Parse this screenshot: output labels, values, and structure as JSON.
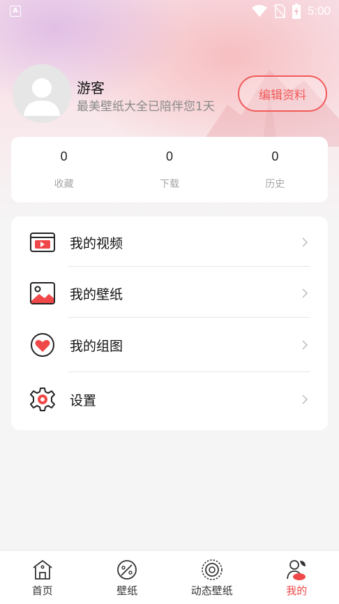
{
  "status_bar": {
    "time": "5:00",
    "icons": [
      "app-notification-icon",
      "wifi-icon",
      "no-sim-icon",
      "battery-icon"
    ]
  },
  "profile": {
    "username": "游客",
    "subtitle": "最美壁纸大全已陪伴您1天",
    "edit_button": "编辑资料"
  },
  "stats": [
    {
      "value": "0",
      "label": "收藏"
    },
    {
      "value": "0",
      "label": "下载"
    },
    {
      "value": "0",
      "label": "历史"
    }
  ],
  "menu": [
    {
      "label": "我的视频",
      "icon": "video-icon"
    },
    {
      "label": "我的壁纸",
      "icon": "picture-icon"
    },
    {
      "label": "我的组图",
      "icon": "heart-album-icon"
    },
    {
      "label": "设置",
      "icon": "settings-gear-icon"
    }
  ],
  "bottom_nav": [
    {
      "label": "首页",
      "icon": "home-icon",
      "active": false
    },
    {
      "label": "壁纸",
      "icon": "palette-icon",
      "active": false
    },
    {
      "label": "动态壁纸",
      "icon": "live-wallpaper-icon",
      "active": false
    },
    {
      "label": "我的",
      "icon": "profile-icon",
      "active": true
    }
  ],
  "colors": {
    "accent": "#f04848",
    "page_background": "#f5f5f5",
    "card_background": "#ffffff"
  }
}
